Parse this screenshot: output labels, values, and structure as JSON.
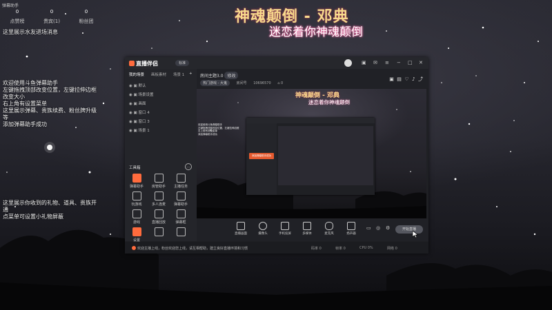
{
  "overlay": {
    "title": "弹幕助手",
    "stats": [
      {
        "value": "0",
        "label": "点赞榜"
      },
      {
        "value": "0",
        "label": "贵宾(1)"
      },
      {
        "value": "0",
        "label": "粉丝团"
      }
    ],
    "notes": {
      "top": "这里展示水友进场消息",
      "middle": [
        "欢迎使用斗鱼弹幕助手",
        "左键拖拽顶部改变位置，左键拉伸边框",
        "改变大小",
        "右上角有设置菜单",
        "这里展示弹幕、贵族续费、粉丝牌升级",
        "等",
        "添加弹幕助手成功"
      ],
      "bottom": [
        "这里展示你收到的礼物、道具、贵族开",
        "通",
        "点菜单可设置小礼物屏蔽"
      ]
    }
  },
  "stream_title": "神魂颠倒 - 邓典",
  "stream_subtitle": "迷恋着你神魂颠倒",
  "app": {
    "logo": "直播伴侣",
    "edition": "标准",
    "sidebar_tabs": [
      "我的场景",
      "画板素材",
      "场景 1"
    ],
    "scenes": [
      "默认",
      "场景设置",
      "画面",
      "窗口 4",
      "窗口 3",
      "场景 1"
    ],
    "tools_title": "工具箱",
    "tools": [
      "弹幕助手",
      "房管助手",
      "主播任务",
      "玩游戏",
      "多人连麦",
      "弹幕助手",
      "游戏",
      "直播回放",
      "弹幕框",
      "设置",
      "",
      ""
    ],
    "room": {
      "title": "房间主题3.0",
      "tag": "修改",
      "category": "热门游戏 - 大鬼",
      "room_label": "房间号",
      "room_id": "10696570",
      "online": "0"
    },
    "controls": [
      "直播画面",
      "摄像头",
      "手机投屏",
      "多媒体",
      "麦克风",
      "扬声器"
    ],
    "start_button": "开始直播",
    "status": {
      "message": "欢迎主播上线，粉丝欢迎您上线，请互相帮助，建立良好直播环境和习惯",
      "stats": [
        "码率 0",
        "帧率 0",
        "CPU 0%",
        "网络 0"
      ]
    }
  }
}
